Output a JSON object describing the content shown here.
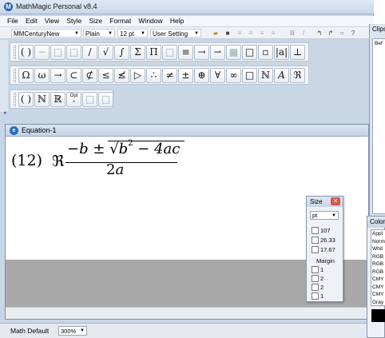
{
  "app": {
    "title": "MathMagic Personal v8.4",
    "icon": "M"
  },
  "menu": [
    "File",
    "Edit",
    "View",
    "Style",
    "Size",
    "Format",
    "Window",
    "Help"
  ],
  "format_bar": {
    "font": "MMCenturyNew",
    "style": "Plain",
    "size": "12 pt",
    "setting": "User Setting",
    "buttons": [
      "≡",
      "≡",
      "≡",
      "≡",
      "B",
      "I",
      "↰",
      "↱",
      "○",
      "?"
    ]
  },
  "palette_rows": [
    [
      "( )",
      "−",
      "□",
      "□",
      "/",
      "√",
      "∫",
      "Σ",
      "Π",
      "□",
      "≡",
      "→",
      "⇀",
      "▦",
      "□",
      "▫",
      "|a|",
      "⊥"
    ],
    [
      "Ω",
      "ω",
      "→",
      "⊂",
      "⊄",
      "≤",
      "≰",
      "▷",
      "∴",
      "≠",
      "±",
      "⊕",
      "∀",
      "∞",
      "□",
      "ℕ",
      "A",
      "ℜ"
    ],
    [
      "( )",
      "ℕ",
      "ℝ",
      "Opt",
      "□",
      "□"
    ]
  ],
  "equation_window": {
    "title": "Equation-1",
    "icon": "e",
    "formula": {
      "label": "(12)",
      "fraktur": "ℜ",
      "numerator_prefix": "−b ± √",
      "numerator_b": "b",
      "exponent": "2",
      "numerator_suffix": " − 4ac",
      "denominator_num": "2",
      "denominator_var": "a"
    }
  },
  "size_palette": {
    "title": "Size",
    "unit": "pt",
    "values": [
      "107",
      "26.33",
      "17.67"
    ],
    "margin_label": "Margin",
    "margins": [
      "1",
      "2",
      "2",
      "1"
    ]
  },
  "clipboard": {
    "title": "Clips",
    "entry": "Bef"
  },
  "color_palette": {
    "title": "Color",
    "items": [
      "Appl",
      "Norm",
      "Whit",
      "RGB",
      "RGB",
      "RGB",
      "CMY",
      "CMY",
      "CMY",
      "Gray"
    ],
    "current": "#000000"
  },
  "status": {
    "mode": "Math Default",
    "zoom": "300%"
  }
}
